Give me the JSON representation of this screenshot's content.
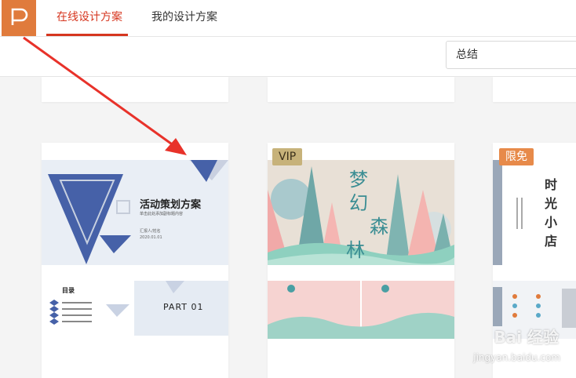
{
  "tabs": [
    {
      "label": "在线设计方案"
    },
    {
      "label": "我的设计方案"
    }
  ],
  "search": {
    "value": "总结"
  },
  "cards": [
    {
      "title": "活动策划方案",
      "subtitle": "单击此处添加副标题内容",
      "reporter": "汇报人/姓名",
      "date": "2020.01.01",
      "toc_title": "目录",
      "part": "PART 01"
    },
    {
      "badge": "VIP",
      "title_chars": [
        "梦",
        "幻",
        "森",
        "林"
      ]
    },
    {
      "badge": "限免",
      "title_chars": [
        "时",
        "光",
        "小",
        "店"
      ]
    }
  ],
  "watermark": {
    "main": "Bai 经验",
    "sub": "jingyan.baidu.com"
  },
  "colors": {
    "accent": "#d6361f",
    "logo": "#e07b3c",
    "arrow": "#e8322a"
  }
}
